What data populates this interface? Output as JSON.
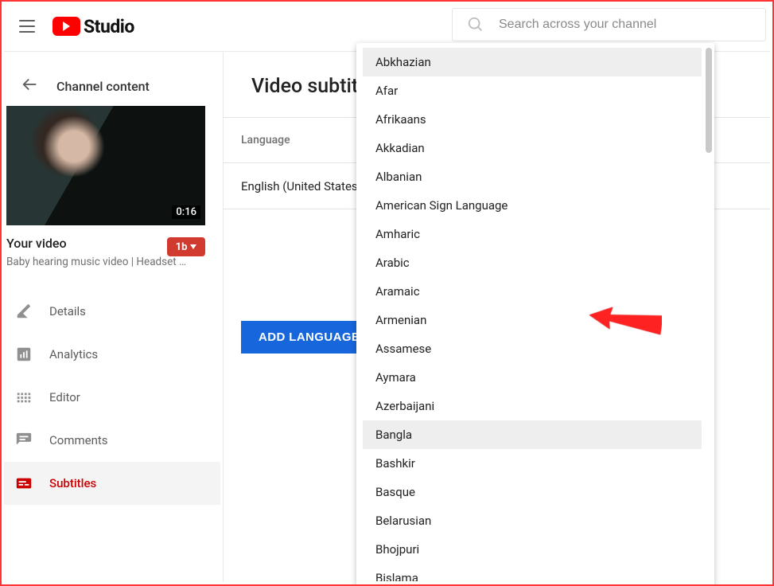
{
  "header": {
    "logo_text": "Studio",
    "search_placeholder": "Search across your channel"
  },
  "back": {
    "label": "Channel content"
  },
  "video": {
    "duration": "0:16",
    "your_video": "Your video",
    "title": "Baby hearing music video | Headset …",
    "badge": "1b"
  },
  "nav": [
    {
      "key": "details",
      "label": "Details"
    },
    {
      "key": "analytics",
      "label": "Analytics"
    },
    {
      "key": "editor",
      "label": "Editor"
    },
    {
      "key": "comments",
      "label": "Comments"
    },
    {
      "key": "subtitles",
      "label": "Subtitles",
      "active": true
    }
  ],
  "main": {
    "title": "Video subtitles",
    "col_language": "Language",
    "row_language": "English (United States)",
    "add_language": "ADD LANGUAGE"
  },
  "dropdown": {
    "items": [
      "Abkhazian",
      "Afar",
      "Afrikaans",
      "Akkadian",
      "Albanian",
      "American Sign Language",
      "Amharic",
      "Arabic",
      "Aramaic",
      "Armenian",
      "Assamese",
      "Aymara",
      "Azerbaijani",
      "Bangla",
      "Bashkir",
      "Basque",
      "Belarusian",
      "Bhojpuri",
      "Bislama"
    ],
    "highlighted": 0,
    "hover": 13
  }
}
